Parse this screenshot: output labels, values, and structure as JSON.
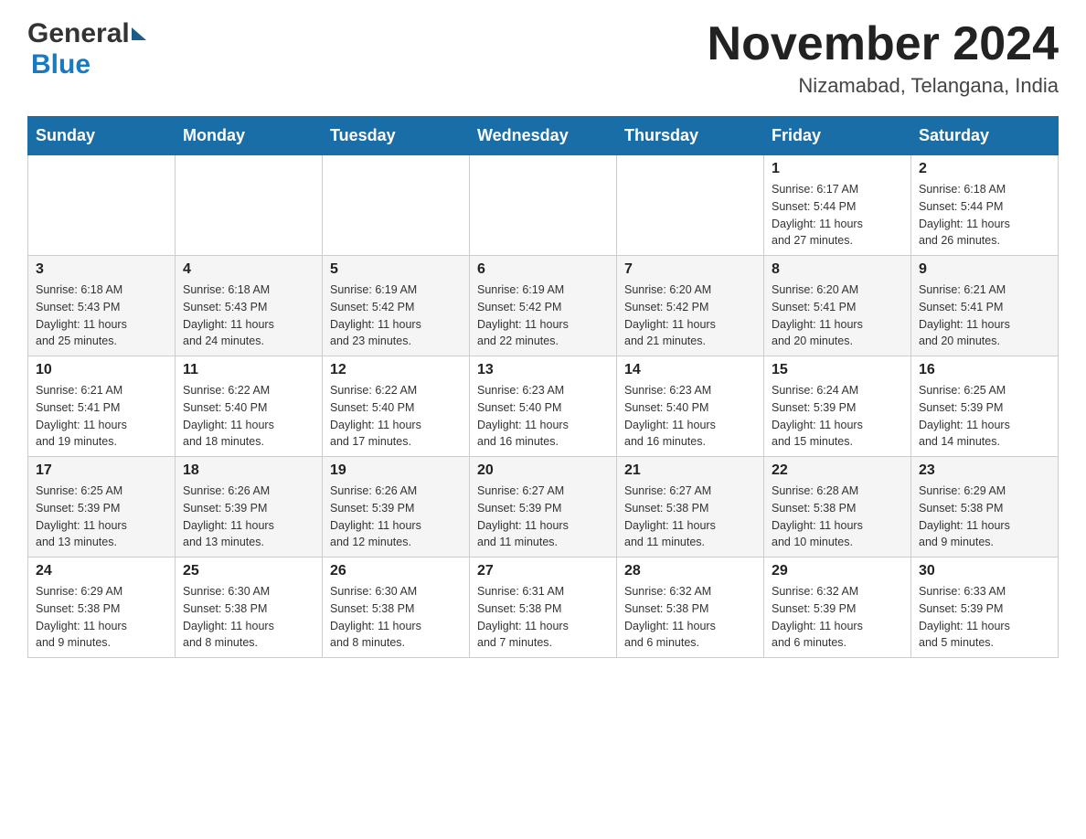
{
  "header": {
    "logo_general": "General",
    "logo_blue": "Blue",
    "month_title": "November 2024",
    "location": "Nizamabad, Telangana, India"
  },
  "weekdays": [
    "Sunday",
    "Monday",
    "Tuesday",
    "Wednesday",
    "Thursday",
    "Friday",
    "Saturday"
  ],
  "weeks": [
    [
      {
        "day": "",
        "info": ""
      },
      {
        "day": "",
        "info": ""
      },
      {
        "day": "",
        "info": ""
      },
      {
        "day": "",
        "info": ""
      },
      {
        "day": "",
        "info": ""
      },
      {
        "day": "1",
        "info": "Sunrise: 6:17 AM\nSunset: 5:44 PM\nDaylight: 11 hours\nand 27 minutes."
      },
      {
        "day": "2",
        "info": "Sunrise: 6:18 AM\nSunset: 5:44 PM\nDaylight: 11 hours\nand 26 minutes."
      }
    ],
    [
      {
        "day": "3",
        "info": "Sunrise: 6:18 AM\nSunset: 5:43 PM\nDaylight: 11 hours\nand 25 minutes."
      },
      {
        "day": "4",
        "info": "Sunrise: 6:18 AM\nSunset: 5:43 PM\nDaylight: 11 hours\nand 24 minutes."
      },
      {
        "day": "5",
        "info": "Sunrise: 6:19 AM\nSunset: 5:42 PM\nDaylight: 11 hours\nand 23 minutes."
      },
      {
        "day": "6",
        "info": "Sunrise: 6:19 AM\nSunset: 5:42 PM\nDaylight: 11 hours\nand 22 minutes."
      },
      {
        "day": "7",
        "info": "Sunrise: 6:20 AM\nSunset: 5:42 PM\nDaylight: 11 hours\nand 21 minutes."
      },
      {
        "day": "8",
        "info": "Sunrise: 6:20 AM\nSunset: 5:41 PM\nDaylight: 11 hours\nand 20 minutes."
      },
      {
        "day": "9",
        "info": "Sunrise: 6:21 AM\nSunset: 5:41 PM\nDaylight: 11 hours\nand 20 minutes."
      }
    ],
    [
      {
        "day": "10",
        "info": "Sunrise: 6:21 AM\nSunset: 5:41 PM\nDaylight: 11 hours\nand 19 minutes."
      },
      {
        "day": "11",
        "info": "Sunrise: 6:22 AM\nSunset: 5:40 PM\nDaylight: 11 hours\nand 18 minutes."
      },
      {
        "day": "12",
        "info": "Sunrise: 6:22 AM\nSunset: 5:40 PM\nDaylight: 11 hours\nand 17 minutes."
      },
      {
        "day": "13",
        "info": "Sunrise: 6:23 AM\nSunset: 5:40 PM\nDaylight: 11 hours\nand 16 minutes."
      },
      {
        "day": "14",
        "info": "Sunrise: 6:23 AM\nSunset: 5:40 PM\nDaylight: 11 hours\nand 16 minutes."
      },
      {
        "day": "15",
        "info": "Sunrise: 6:24 AM\nSunset: 5:39 PM\nDaylight: 11 hours\nand 15 minutes."
      },
      {
        "day": "16",
        "info": "Sunrise: 6:25 AM\nSunset: 5:39 PM\nDaylight: 11 hours\nand 14 minutes."
      }
    ],
    [
      {
        "day": "17",
        "info": "Sunrise: 6:25 AM\nSunset: 5:39 PM\nDaylight: 11 hours\nand 13 minutes."
      },
      {
        "day": "18",
        "info": "Sunrise: 6:26 AM\nSunset: 5:39 PM\nDaylight: 11 hours\nand 13 minutes."
      },
      {
        "day": "19",
        "info": "Sunrise: 6:26 AM\nSunset: 5:39 PM\nDaylight: 11 hours\nand 12 minutes."
      },
      {
        "day": "20",
        "info": "Sunrise: 6:27 AM\nSunset: 5:39 PM\nDaylight: 11 hours\nand 11 minutes."
      },
      {
        "day": "21",
        "info": "Sunrise: 6:27 AM\nSunset: 5:38 PM\nDaylight: 11 hours\nand 11 minutes."
      },
      {
        "day": "22",
        "info": "Sunrise: 6:28 AM\nSunset: 5:38 PM\nDaylight: 11 hours\nand 10 minutes."
      },
      {
        "day": "23",
        "info": "Sunrise: 6:29 AM\nSunset: 5:38 PM\nDaylight: 11 hours\nand 9 minutes."
      }
    ],
    [
      {
        "day": "24",
        "info": "Sunrise: 6:29 AM\nSunset: 5:38 PM\nDaylight: 11 hours\nand 9 minutes."
      },
      {
        "day": "25",
        "info": "Sunrise: 6:30 AM\nSunset: 5:38 PM\nDaylight: 11 hours\nand 8 minutes."
      },
      {
        "day": "26",
        "info": "Sunrise: 6:30 AM\nSunset: 5:38 PM\nDaylight: 11 hours\nand 8 minutes."
      },
      {
        "day": "27",
        "info": "Sunrise: 6:31 AM\nSunset: 5:38 PM\nDaylight: 11 hours\nand 7 minutes."
      },
      {
        "day": "28",
        "info": "Sunrise: 6:32 AM\nSunset: 5:38 PM\nDaylight: 11 hours\nand 6 minutes."
      },
      {
        "day": "29",
        "info": "Sunrise: 6:32 AM\nSunset: 5:39 PM\nDaylight: 11 hours\nand 6 minutes."
      },
      {
        "day": "30",
        "info": "Sunrise: 6:33 AM\nSunset: 5:39 PM\nDaylight: 11 hours\nand 5 minutes."
      }
    ]
  ]
}
